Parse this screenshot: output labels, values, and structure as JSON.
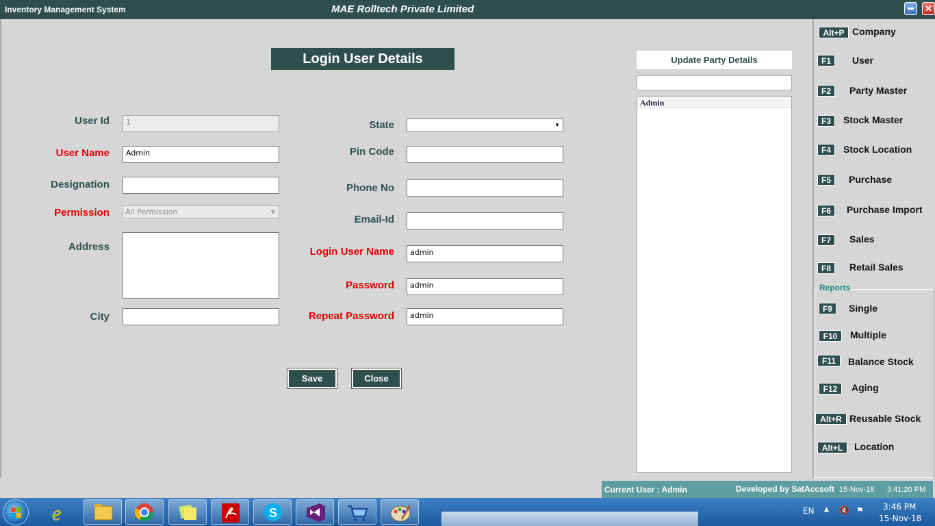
{
  "titlebar": {
    "app_name": "Inventory Management System",
    "company": "MAE Rolltech Private Limited",
    "close_glyph": "✕"
  },
  "form": {
    "heading": "Login User Details",
    "user_id": {
      "label": "User Id",
      "value": "1"
    },
    "user_name": {
      "label": "User Name",
      "value": "Admin"
    },
    "designation": {
      "label": "Designation",
      "value": ""
    },
    "permission": {
      "label": "Permission",
      "value": "All Permission"
    },
    "address": {
      "label": "Address",
      "value": ""
    },
    "city": {
      "label": "City",
      "value": ""
    },
    "state": {
      "label": "State",
      "value": ""
    },
    "pin_code": {
      "label": "Pin Code",
      "value": ""
    },
    "phone_no": {
      "label": "Phone No",
      "value": ""
    },
    "email_id": {
      "label": "Email-Id",
      "value": ""
    },
    "login_user_name": {
      "label": "Login User Name",
      "value": "admin"
    },
    "password": {
      "label": "Password",
      "value": "admin"
    },
    "repeat_password": {
      "label": "Repeat Password",
      "value": "admin"
    },
    "save_label": "Save",
    "close_label": "Close"
  },
  "update_panel": {
    "title": "Update Party Details",
    "search_value": "",
    "list_header": "Admin"
  },
  "sidebar": {
    "items": [
      {
        "key": "Alt+P",
        "label": "Company"
      },
      {
        "key": "F1",
        "label": "User"
      },
      {
        "key": "F2",
        "label": "Party Master"
      },
      {
        "key": "F3",
        "label": "Stock Master"
      },
      {
        "key": "F4",
        "label": "Stock Location"
      },
      {
        "key": "F5",
        "label": "Purchase"
      },
      {
        "key": "F6",
        "label": "Purchase Import"
      },
      {
        "key": "F7",
        "label": "Sales"
      },
      {
        "key": "F8",
        "label": "Retail Sales"
      }
    ],
    "reports_label": "Reports",
    "reports": [
      {
        "key": "F9",
        "label": "Single"
      },
      {
        "key": "F10",
        "label": "Multiple"
      },
      {
        "key": "F11",
        "label": "Balance Stock"
      },
      {
        "key": "F12",
        "label": "Aging"
      },
      {
        "key": "Alt+R",
        "label": "Reusable Stock"
      },
      {
        "key": "Alt+L",
        "label": "Location"
      }
    ]
  },
  "statusbar": {
    "current_user": "Current User : Admin",
    "developer": "Developed by SatAccsoft",
    "date": "15-Nov-18",
    "time": "3:41:20 PM"
  },
  "taskbar": {
    "language": "EN",
    "clock_time": "3:46 PM",
    "clock_date": "15-Nov-18",
    "apps": [
      "internet-explorer-icon",
      "file-explorer-icon",
      "chrome-icon",
      "sticky-notes-icon",
      "acrobat-icon",
      "skype-icon",
      "visual-studio-icon",
      "shopping-cart-icon",
      "paint-icon"
    ]
  },
  "colors": {
    "accent": "#2f4f4f",
    "required": "#e00000",
    "status": "#5f9ea0",
    "background": "#d6d6d6"
  }
}
